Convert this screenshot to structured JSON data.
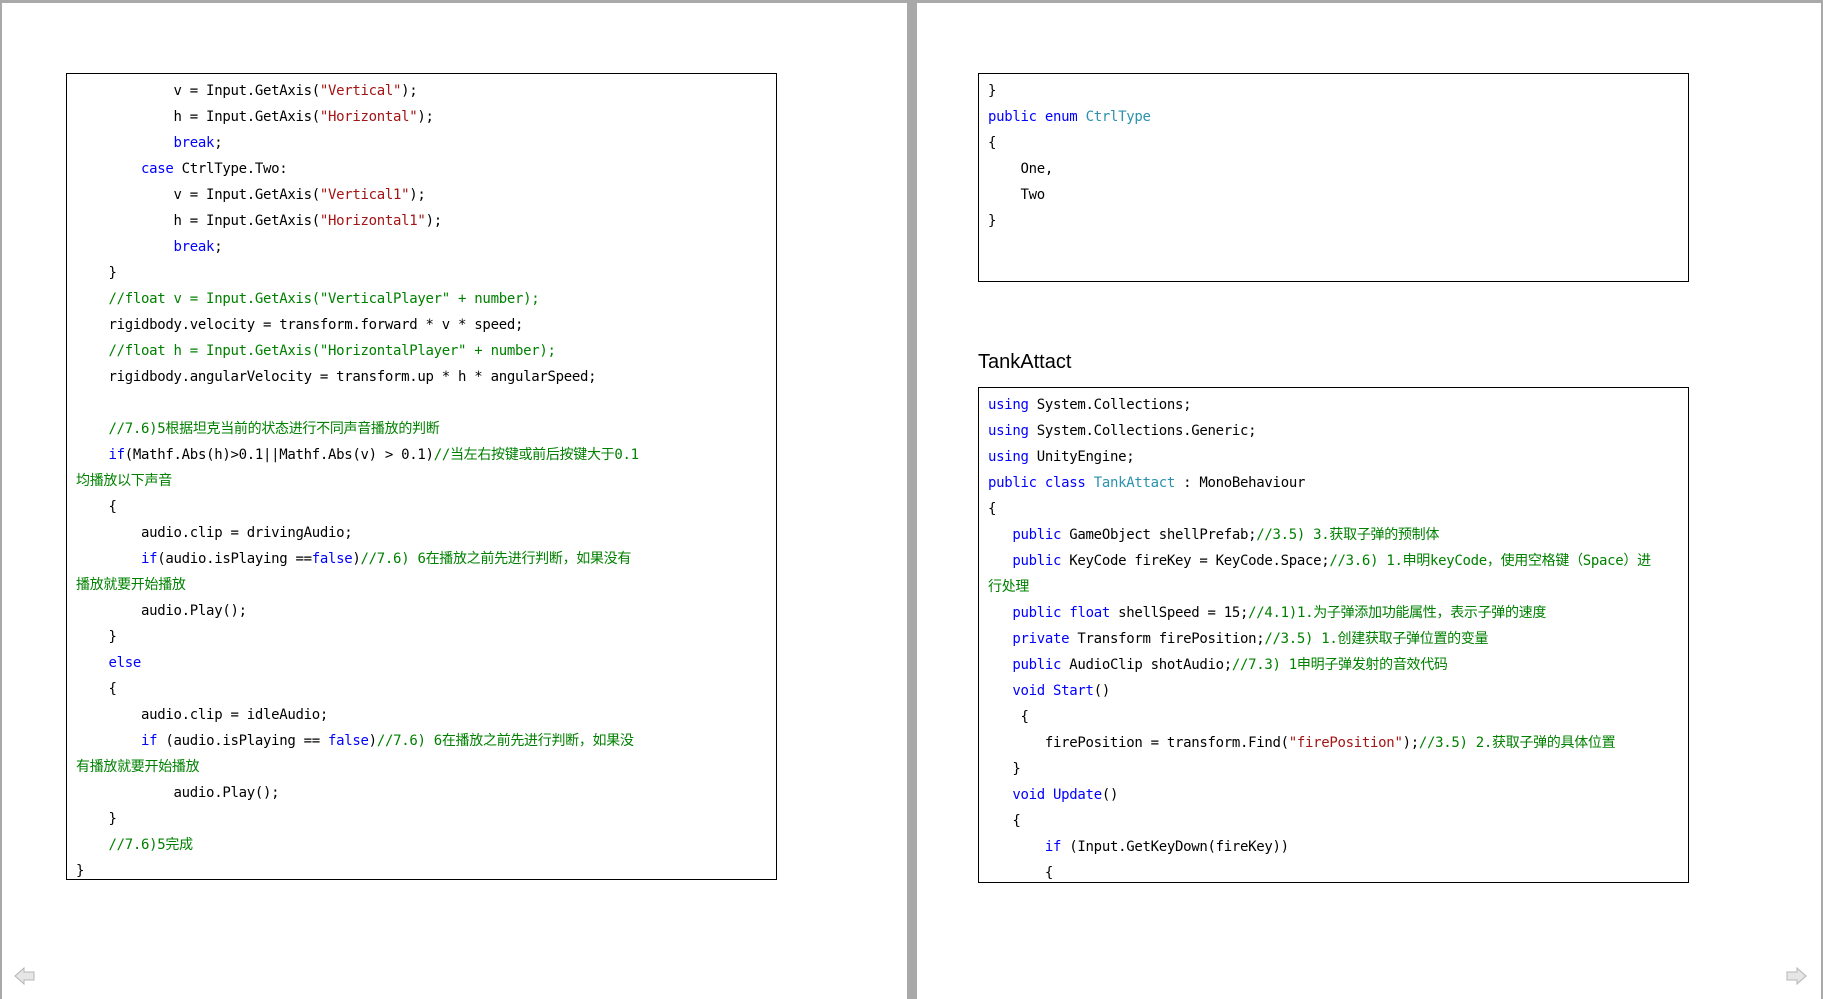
{
  "left_page": {
    "code_lines": [
      [
        {
          "t": "            v = Input.GetAxis("
        },
        {
          "t": "\"Vertical\"",
          "c": "s"
        },
        {
          "t": ");"
        }
      ],
      [
        {
          "t": "            h = Input.GetAxis("
        },
        {
          "t": "\"Horizontal\"",
          "c": "s"
        },
        {
          "t": ");"
        }
      ],
      [
        {
          "t": "            "
        },
        {
          "t": "break",
          "c": "k"
        },
        {
          "t": ";"
        }
      ],
      [
        {
          "t": "        "
        },
        {
          "t": "case",
          "c": "k"
        },
        {
          "t": " CtrlType.Two:"
        }
      ],
      [
        {
          "t": "            v = Input.GetAxis("
        },
        {
          "t": "\"Vertical1\"",
          "c": "s"
        },
        {
          "t": ");"
        }
      ],
      [
        {
          "t": "            h = Input.GetAxis("
        },
        {
          "t": "\"Horizontal1\"",
          "c": "s"
        },
        {
          "t": ");"
        }
      ],
      [
        {
          "t": "            "
        },
        {
          "t": "break",
          "c": "k"
        },
        {
          "t": ";"
        }
      ],
      [
        {
          "t": "    }"
        }
      ],
      [
        {
          "t": "    "
        },
        {
          "t": "//float v = Input.GetAxis(\"VerticalPlayer\" + number);",
          "c": "c"
        }
      ],
      [
        {
          "t": "    rigidbody.velocity = transform.forward * v * speed;"
        }
      ],
      [
        {
          "t": "    "
        },
        {
          "t": "//float h = Input.GetAxis(\"HorizontalPlayer\" + number);",
          "c": "c"
        }
      ],
      [
        {
          "t": "    rigidbody.angularVelocity = transform.up * h * angularSpeed;"
        }
      ],
      [
        {
          "t": ""
        }
      ],
      [
        {
          "t": "    "
        },
        {
          "t": "//7.6)5根据坦克当前的状态进行不同声音播放的判断",
          "c": "c"
        }
      ],
      [
        {
          "t": "    "
        },
        {
          "t": "if",
          "c": "k"
        },
        {
          "t": "(Mathf.Abs(h)>0.1||Mathf.Abs(v) > 0.1)"
        },
        {
          "t": "//当左右按键或前后按键大于0.1",
          "c": "c"
        }
      ],
      [
        {
          "t": "均播放以下声音",
          "c": "c"
        }
      ],
      [
        {
          "t": "    {"
        }
      ],
      [
        {
          "t": "        audio.clip = drivingAudio;"
        }
      ],
      [
        {
          "t": "        "
        },
        {
          "t": "if",
          "c": "k"
        },
        {
          "t": "(audio.isPlaying =="
        },
        {
          "t": "false",
          "c": "k"
        },
        {
          "t": ")"
        },
        {
          "t": "//7.6) 6在播放之前先进行判断，如果没有",
          "c": "c"
        }
      ],
      [
        {
          "t": "播放就要开始播放",
          "c": "c"
        }
      ],
      [
        {
          "t": "        audio.Play();"
        }
      ],
      [
        {
          "t": "    }"
        }
      ],
      [
        {
          "t": "    "
        },
        {
          "t": "else",
          "c": "k"
        }
      ],
      [
        {
          "t": "    {"
        }
      ],
      [
        {
          "t": "        audio.clip = idleAudio;"
        }
      ],
      [
        {
          "t": "        "
        },
        {
          "t": "if",
          "c": "k"
        },
        {
          "t": " (audio.isPlaying == "
        },
        {
          "t": "false",
          "c": "k"
        },
        {
          "t": ")"
        },
        {
          "t": "//7.6) 6在播放之前先进行判断，如果没",
          "c": "c"
        }
      ],
      [
        {
          "t": "有播放就要开始播放",
          "c": "c"
        }
      ],
      [
        {
          "t": "            audio.Play();"
        }
      ],
      [
        {
          "t": "    }"
        }
      ],
      [
        {
          "t": "    "
        },
        {
          "t": "//7.6)5完成",
          "c": "c"
        }
      ],
      [
        {
          "t": "}"
        }
      ]
    ]
  },
  "right_page": {
    "top_code_lines": [
      [
        {
          "t": "}"
        }
      ],
      [
        {
          "t": "public",
          "c": "k"
        },
        {
          "t": " "
        },
        {
          "t": "enum",
          "c": "k"
        },
        {
          "t": " "
        },
        {
          "t": "CtrlType",
          "c": "t"
        }
      ],
      [
        {
          "t": "{"
        }
      ],
      [
        {
          "t": "    One,"
        }
      ],
      [
        {
          "t": "    Two"
        }
      ],
      [
        {
          "t": "}"
        }
      ]
    ],
    "heading": "TankAttact",
    "code_lines": [
      [
        {
          "t": "using",
          "c": "k"
        },
        {
          "t": " System.Collections;"
        }
      ],
      [
        {
          "t": "using",
          "c": "k"
        },
        {
          "t": " System.Collections.Generic;"
        }
      ],
      [
        {
          "t": "using",
          "c": "k"
        },
        {
          "t": " UnityEngine;"
        }
      ],
      [
        {
          "t": "public",
          "c": "k"
        },
        {
          "t": " "
        },
        {
          "t": "class",
          "c": "k"
        },
        {
          "t": " "
        },
        {
          "t": "TankAttact",
          "c": "t"
        },
        {
          "t": " : MonoBehaviour"
        }
      ],
      [
        {
          "t": "{"
        }
      ],
      [
        {
          "t": "   "
        },
        {
          "t": "public",
          "c": "k"
        },
        {
          "t": " GameObject shellPrefab;"
        },
        {
          "t": "//3.5) 3.获取子弹的预制体",
          "c": "c"
        }
      ],
      [
        {
          "t": "   "
        },
        {
          "t": "public",
          "c": "k"
        },
        {
          "t": " KeyCode fireKey = KeyCode.Space;"
        },
        {
          "t": "//3.6) 1.申明keyCode，使用空格键（Space）进",
          "c": "c"
        }
      ],
      [
        {
          "t": "行处理",
          "c": "c"
        }
      ],
      [
        {
          "t": "   "
        },
        {
          "t": "public",
          "c": "k"
        },
        {
          "t": " "
        },
        {
          "t": "float",
          "c": "k"
        },
        {
          "t": " shellSpeed = 15;"
        },
        {
          "t": "//4.1)1.为子弹添加功能属性，表示子弹的速度",
          "c": "c"
        }
      ],
      [
        {
          "t": "   "
        },
        {
          "t": "private",
          "c": "k"
        },
        {
          "t": " Transform firePosition;"
        },
        {
          "t": "//3.5) 1.创建获取子弹位置的变量",
          "c": "c"
        }
      ],
      [
        {
          "t": "   "
        },
        {
          "t": "public",
          "c": "k"
        },
        {
          "t": " AudioClip shotAudio;"
        },
        {
          "t": "//7.3) 1申明子弹发射的音效代码",
          "c": "c"
        }
      ],
      [
        {
          "t": "   "
        },
        {
          "t": "void",
          "c": "k"
        },
        {
          "t": " "
        },
        {
          "t": "Start",
          "c": "k"
        },
        {
          "t": "()"
        }
      ],
      [
        {
          "t": "    {"
        }
      ],
      [
        {
          "t": "       firePosition = transform.Find("
        },
        {
          "t": "\"firePosition\"",
          "c": "s"
        },
        {
          "t": ");"
        },
        {
          "t": "//3.5) 2.获取子弹的具体位置",
          "c": "c"
        }
      ],
      [
        {
          "t": "   }"
        }
      ],
      [
        {
          "t": "   "
        },
        {
          "t": "void",
          "c": "k"
        },
        {
          "t": " "
        },
        {
          "t": "Update",
          "c": "k"
        },
        {
          "t": "()"
        }
      ],
      [
        {
          "t": "   {"
        }
      ],
      [
        {
          "t": "       "
        },
        {
          "t": "if",
          "c": "k"
        },
        {
          "t": " (Input.GetKeyDown(fireKey))"
        }
      ],
      [
        {
          "t": "       {"
        }
      ]
    ]
  },
  "navigation": {
    "prev_icon": "arrow-left-icon",
    "next_icon": "arrow-right-icon"
  },
  "colors": {
    "keyword": "#0000ff",
    "type": "#2b91af",
    "string": "#a31515",
    "comment": "#008000",
    "background": "#a9a9a9"
  }
}
